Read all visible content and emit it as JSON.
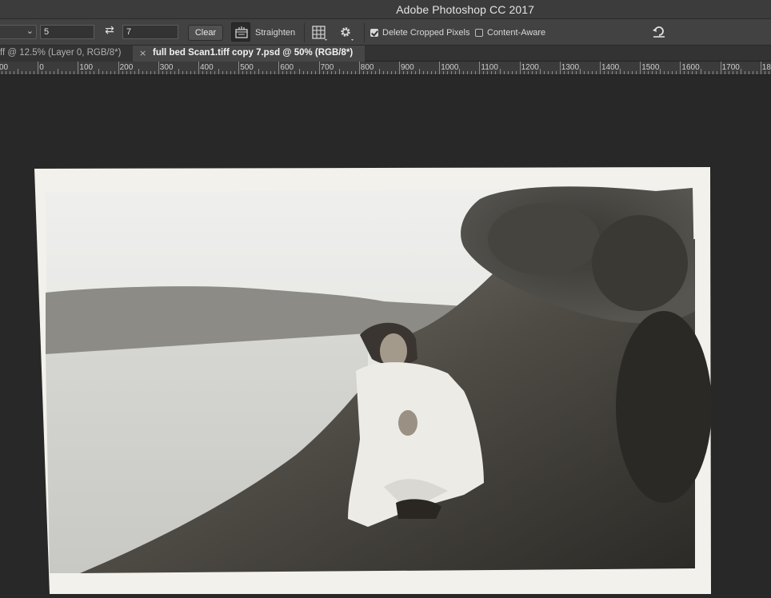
{
  "app": {
    "title": "Adobe Photoshop CC 2017"
  },
  "options_bar": {
    "ratio_width": "5",
    "ratio_height": "7",
    "clear_label": "Clear",
    "straighten_label": "Straighten",
    "delete_cropped_label": "Delete Cropped Pixels",
    "delete_cropped_checked": true,
    "content_aware_label": "Content-Aware",
    "content_aware_checked": false,
    "icons": [
      "chevron-down-icon",
      "swap-icon",
      "straighten-icon",
      "grid-overlay-icon",
      "gear-icon",
      "reset-icon"
    ]
  },
  "tabs": [
    {
      "label": "ff @ 12.5% (Layer 0, RGB/8*)",
      "active": false
    },
    {
      "label": "full bed Scan1.tiff copy 7.psd @ 50% (RGB/8*)",
      "active": true,
      "close": "×"
    }
  ],
  "ruler": {
    "labels": [
      "00",
      "0",
      "100",
      "200",
      "300",
      "400",
      "500",
      "600",
      "700",
      "800",
      "900",
      "1000",
      "1100",
      "1200",
      "1300",
      "1400",
      "1500",
      "1600",
      "1700",
      "180"
    ]
  },
  "colors": {
    "canvas_bg": "#282828",
    "options_bg": "#424242",
    "titlebar_bg": "#3c3c3c"
  }
}
